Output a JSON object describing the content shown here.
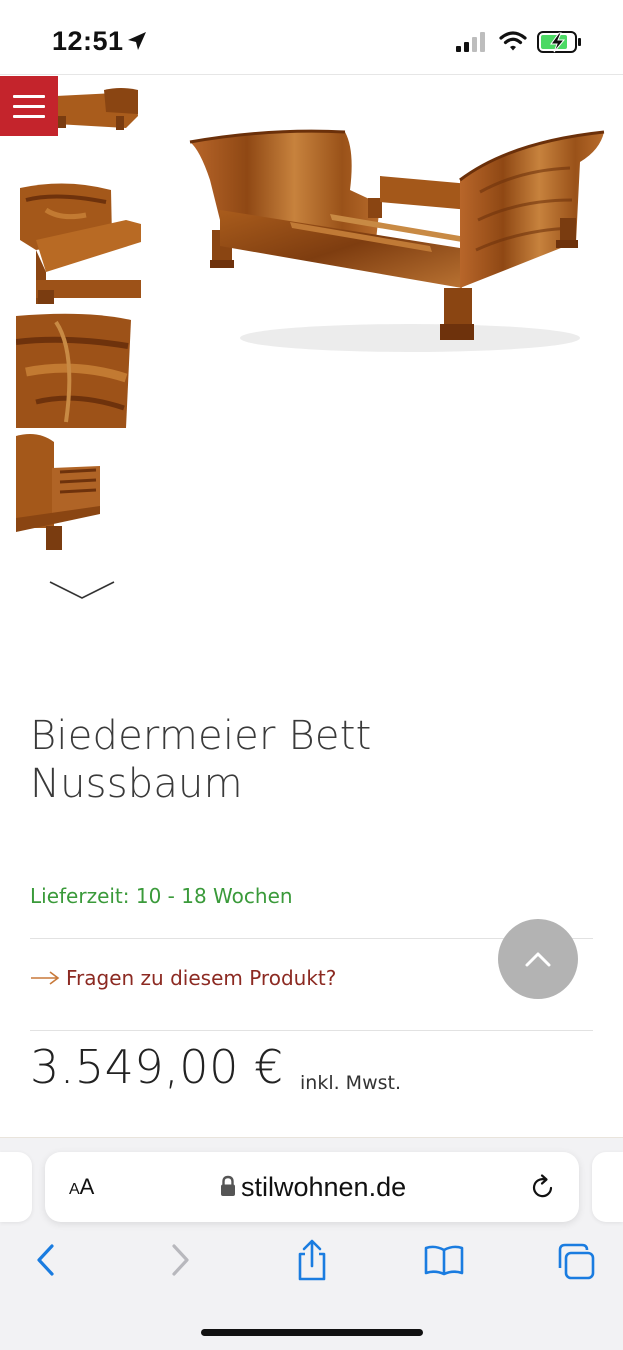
{
  "status_bar": {
    "time": "12:51"
  },
  "product": {
    "title_line1": "Biedermeier Bett",
    "title_line2": "Nussbaum",
    "delivery": "Lieferzeit: 10 - 18 Wochen",
    "question_link": "Fragen zu diesem Produkt?",
    "price": "3.549,00 €",
    "vat_note": "inkl. Mwst."
  },
  "browser": {
    "text_size_label_small": "A",
    "text_size_label_large": "A",
    "url": "stilwohnen.de"
  },
  "colors": {
    "menu_red": "#c4242c",
    "delivery_green": "#3a9a3a",
    "link_red": "#8c2a22",
    "arrow_orange": "#c8793a",
    "safari_blue": "#1a7ce0",
    "wood": "#a4581a"
  },
  "icons": [
    "location-arrow-icon",
    "signal-icon",
    "wifi-icon",
    "battery-charging-icon",
    "menu-icon",
    "chevron-down-icon",
    "arrow-right-icon",
    "chevron-up-icon",
    "lock-icon",
    "reload-icon",
    "back-icon",
    "forward-icon",
    "share-icon",
    "bookmarks-icon",
    "tabs-icon"
  ]
}
